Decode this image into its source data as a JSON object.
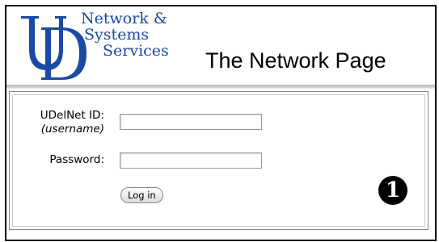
{
  "header": {
    "logo_line1": "Network &",
    "logo_line2": "Systems",
    "logo_line3": "Services",
    "page_title": "The Network Page"
  },
  "login": {
    "uid_label": "UDelNet ID:",
    "uid_sublabel": "(username)",
    "uid_value": "",
    "password_label": "Password:",
    "password_value": "",
    "login_button_label": "Log in"
  },
  "annotation": {
    "step_marker": "1"
  },
  "colors": {
    "logo_blue": "#1a4aa6"
  }
}
